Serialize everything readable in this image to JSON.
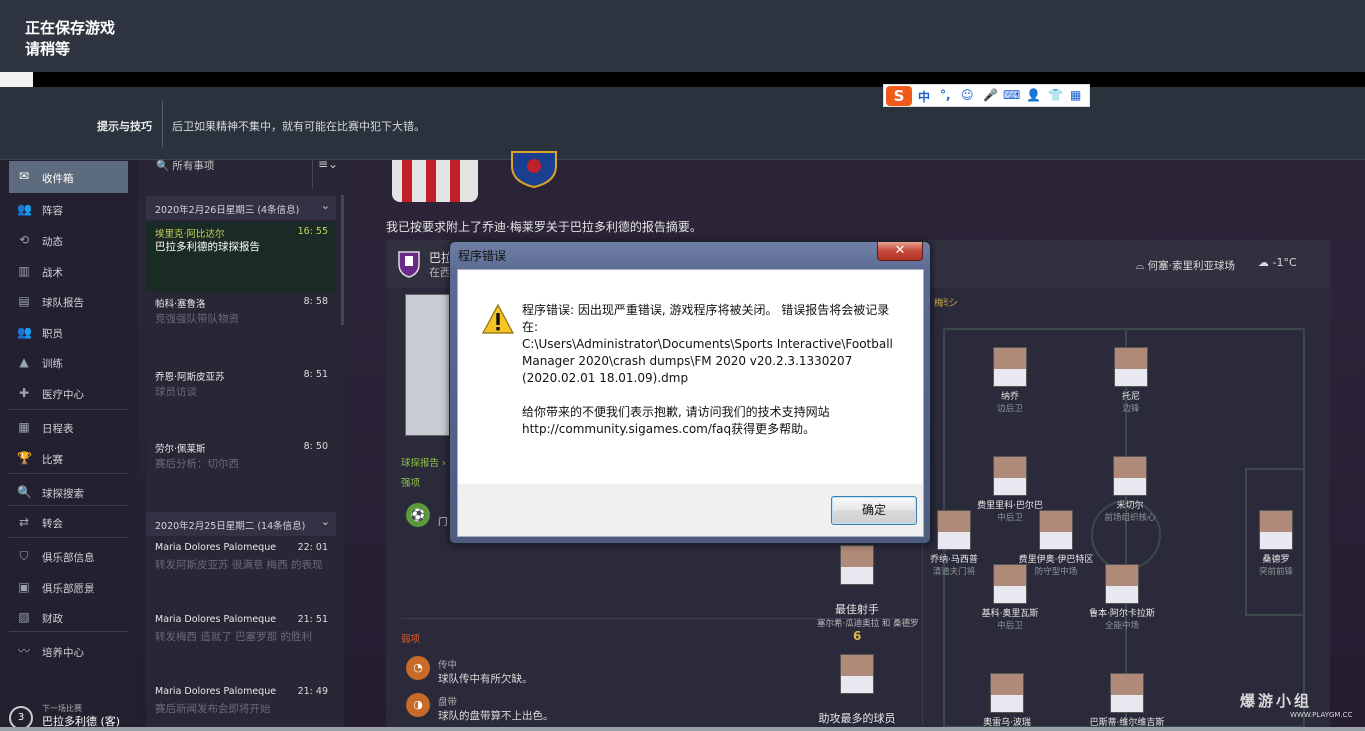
{
  "saving": {
    "line1": "正在保存游戏",
    "line2": "请稍等"
  },
  "tips": {
    "label": "提示与技巧",
    "text": "后卫如果精神不集中，就有可能在比赛中犯下大错。"
  },
  "ime": {
    "logo": "S",
    "items": [
      "中",
      "°,",
      "☺",
      "🎤",
      "⌨",
      "👤",
      "👕",
      "▦"
    ]
  },
  "sidebar": {
    "items": [
      {
        "label": "收件箱",
        "icon": "inbox-icon",
        "glyph": "✉"
      },
      {
        "label": "阵容",
        "icon": "squad-icon",
        "glyph": "👥"
      },
      {
        "label": "动态",
        "icon": "dynamics-icon",
        "glyph": "⟲"
      },
      {
        "label": "战术",
        "icon": "tactics-icon",
        "glyph": "▥"
      },
      {
        "label": "球队报告",
        "icon": "report-icon",
        "glyph": "▤"
      },
      {
        "label": "职员",
        "icon": "staff-icon",
        "glyph": "👥"
      },
      {
        "label": "训练",
        "icon": "training-icon",
        "glyph": "▲"
      },
      {
        "label": "医疗中心",
        "icon": "medical-icon",
        "glyph": "✚"
      },
      {
        "label": "日程表",
        "icon": "calendar-icon",
        "glyph": "▦"
      },
      {
        "label": "比赛",
        "icon": "trophy-icon",
        "glyph": "🏆"
      },
      {
        "label": "球探搜索",
        "icon": "scouting-icon",
        "glyph": "🔍"
      },
      {
        "label": "转会",
        "icon": "transfer-icon",
        "glyph": "⇄"
      },
      {
        "label": "俱乐部信息",
        "icon": "club-info-icon",
        "glyph": "⛉"
      },
      {
        "label": "俱乐部愿景",
        "icon": "club-vision-icon",
        "glyph": "▣"
      },
      {
        "label": "财政",
        "icon": "finance-icon",
        "glyph": "▨"
      },
      {
        "label": "培养中心",
        "icon": "development-icon",
        "glyph": "〰"
      }
    ],
    "next_label": "下一场比赛",
    "next_match": "巴拉多利德 (客)",
    "next_num": "3"
  },
  "inbox": {
    "search": "所有事项",
    "filter": "≡⌄",
    "groups": [
      {
        "title": "2020年2月26日星期三 (4条信息)",
        "chev": "⌄"
      },
      {
        "title": "2020年2月25日星期二 (14条信息)",
        "chev": "⌄"
      }
    ],
    "messages": [
      {
        "from": "埃里克·阿比达尔",
        "time": "16: 55",
        "subject": "巴拉多利德的球探报告"
      },
      {
        "from": "帕科·塞鲁洛",
        "time": "8: 58",
        "subject": "竞强强队带队物资"
      },
      {
        "from": "乔恩·阿斯皮亚苏",
        "time": "8: 51",
        "subject": "球员访谈"
      },
      {
        "from": "劳尔·佩莱斯",
        "time": "8: 50",
        "subject": "赛后分析：切尔西"
      },
      {
        "from": "Maria Dolores Palomeque",
        "time": "22: 01",
        "subject": "转发阿斯皮亚苏 很满意 梅西 的表现"
      },
      {
        "from": "Maria Dolores Palomeque",
        "time": "21: 51",
        "subject": "转发梅西 造就了 巴塞罗那 的胜利"
      },
      {
        "from": "Maria Dolores Palomeque",
        "time": "21: 49",
        "subject": "赛后新闻发布会即将开始"
      }
    ]
  },
  "report": {
    "intro": "我已按要求附上了乔迪·梅莱罗关于巴拉多利德的报告摘要。",
    "team": "巴拉",
    "team_sub": "在西",
    "venue": "何塞·索里利亚球场",
    "temp": "-1°C",
    "formation": "梅ইシ",
    "scout_link": "球探报告 ›",
    "strengths": "强项",
    "strength_line1": "门",
    "weakness": "弱项",
    "w1_title": "传中",
    "w1_text": "球队传中有所欠缺。",
    "w2_title": "盘带",
    "w2_text": "球队的盘带算不上出色。",
    "best_player": "最佳射手",
    "best_name": "塞尔希·瓜迪奥拉 和 桑德罗",
    "best_goals": "6",
    "bottom_label": "助攻最多的球员"
  },
  "pitch_players": [
    {
      "name": "纳乔",
      "pos": "边后卫"
    },
    {
      "name": "托尼",
      "pos": "边锋"
    },
    {
      "name": "费里里科·巴尔巴",
      "pos": "中后卫"
    },
    {
      "name": "米切尔",
      "pos": "前场组织核心"
    },
    {
      "name": "乔纳·马西普",
      "pos": "清道夫门将"
    },
    {
      "name": "费里伊奥·伊巴特区",
      "pos": "防守型中场"
    },
    {
      "name": "桑德罗",
      "pos": "突前前锋"
    },
    {
      "name": "基科·奥里瓦斯",
      "pos": "中后卫"
    },
    {
      "name": "鲁本·阿尔卡拉斯",
      "pos": "全能中场"
    },
    {
      "name": "奥雷乌·波瑞",
      "pos": ""
    },
    {
      "name": "巴斯蒂·维尔维吉斯",
      "pos": ""
    }
  ],
  "dialog": {
    "title": "程序错误",
    "close": "✕",
    "line1": "程序错误: 因出现严重错误, 游戏程序将被关闭。 错误报告将会被记录在:",
    "path": "C:\\Users\\Administrator\\Documents\\Sports Interactive\\Football Manager 2020\\crash dumps\\FM 2020 v20.2.3.1330207 (2020.02.01 18.01.09).dmp",
    "line2": "给你带来的不便我们表示抱歉, 请访问我们的技术支持网站 http://community.sigames.com/faq获得更多帮助。",
    "ok": "确定"
  },
  "watermark": {
    "title": "爆游小组",
    "url": "WWW.PLAYGM.CC"
  }
}
